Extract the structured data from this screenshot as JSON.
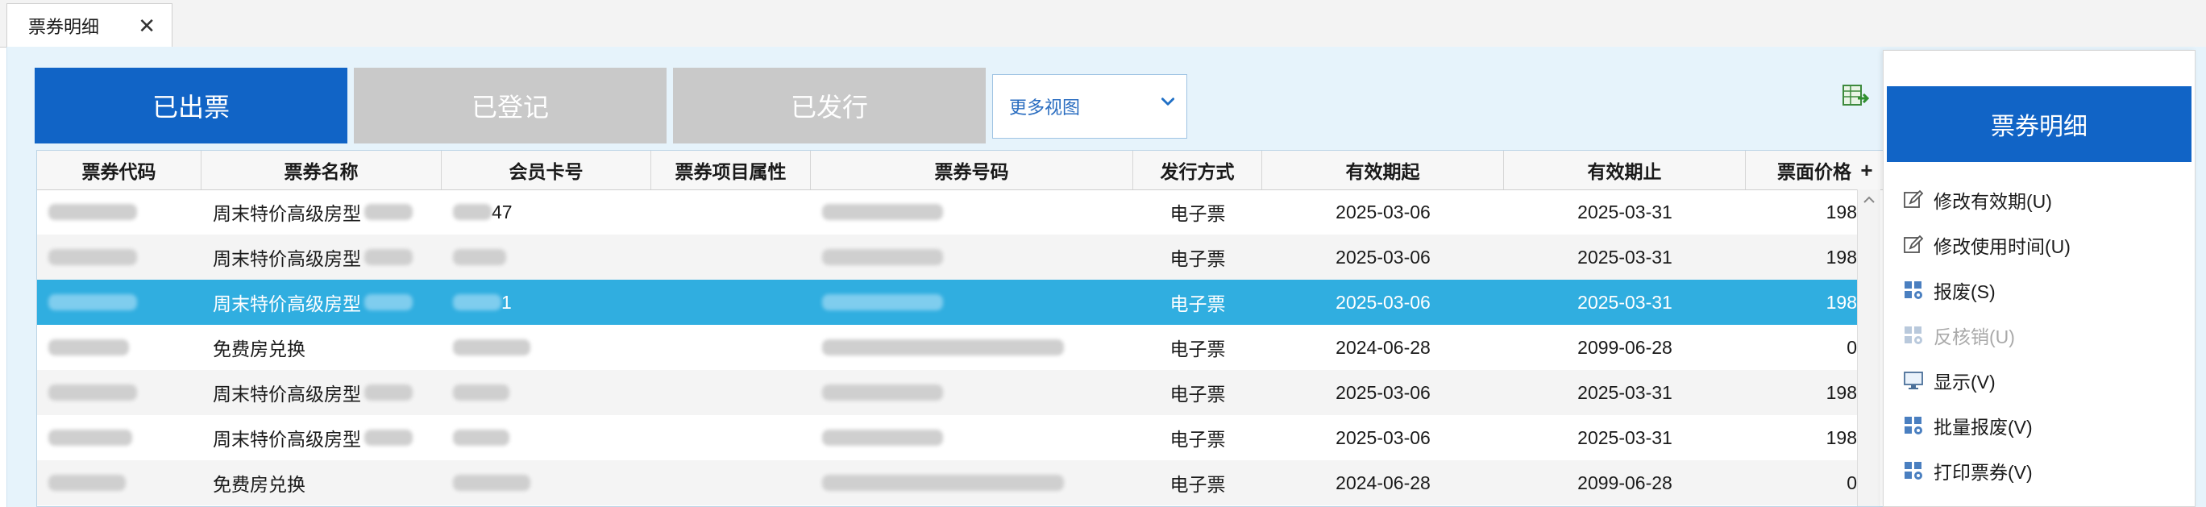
{
  "tab": {
    "label": "票券明细",
    "close": "✕"
  },
  "views": {
    "issued": "已出票",
    "registered": "已登记",
    "published": "已发行",
    "more": "更多视图"
  },
  "grid": {
    "columns": [
      "票券代码",
      "票券名称",
      "会员卡号",
      "票券项目属性",
      "票券号码",
      "发行方式",
      "有效期起",
      "有效期止",
      "票面价格"
    ],
    "add_column": "+",
    "rows": [
      {
        "name": "周末特价高级房型",
        "card_tail": "47",
        "mode": "电子票",
        "from": "2025-03-06",
        "to": "2025-03-31",
        "price": "198"
      },
      {
        "name": "周末特价高级房型",
        "card_tail": "",
        "mode": "电子票",
        "from": "2025-03-06",
        "to": "2025-03-31",
        "price": "198"
      },
      {
        "name": "周末特价高级房型",
        "card_tail": "1",
        "mode": "电子票",
        "from": "2025-03-06",
        "to": "2025-03-31",
        "price": "198"
      },
      {
        "name": "免费房兑换",
        "card_tail": "",
        "mode": "电子票",
        "from": "2024-06-28",
        "to": "2099-06-28",
        "price": "0"
      },
      {
        "name": "周末特价高级房型",
        "card_tail": "",
        "mode": "电子票",
        "from": "2025-03-06",
        "to": "2025-03-31",
        "price": "198"
      },
      {
        "name": "周末特价高级房型",
        "card_tail": "",
        "mode": "电子票",
        "from": "2025-03-06",
        "to": "2025-03-31",
        "price": "198"
      },
      {
        "name": "免费房兑换",
        "card_tail": "",
        "mode": "电子票",
        "from": "2024-06-28",
        "to": "2099-06-28",
        "price": "0"
      }
    ],
    "selected_row": 2
  },
  "menu": {
    "title": "票券明细",
    "items": [
      {
        "label": "修改有效期(U)",
        "icon": "edit-icon",
        "enabled": true
      },
      {
        "label": "修改使用时间(U)",
        "icon": "edit-icon",
        "enabled": true
      },
      {
        "label": "报废(S)",
        "icon": "gear-blocks-icon",
        "enabled": true
      },
      {
        "label": "反核销(U)",
        "icon": "gear-blocks-icon",
        "enabled": false
      },
      {
        "label": "显示(V)",
        "icon": "monitor-icon",
        "enabled": true
      },
      {
        "label": "批量报废(V)",
        "icon": "gear-blocks-icon",
        "enabled": true
      },
      {
        "label": "打印票券(V)",
        "icon": "gear-blocks-icon",
        "enabled": true
      }
    ]
  },
  "colors": {
    "accent": "#1164c6",
    "selection": "#30aee0",
    "inactive": "#c9c9c9",
    "background": "#e6f3fb"
  }
}
